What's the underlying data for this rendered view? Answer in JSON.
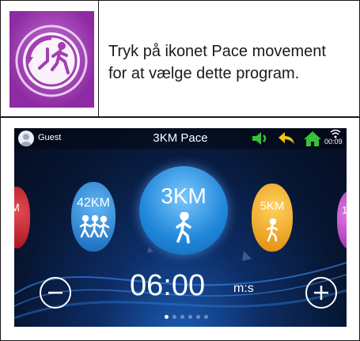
{
  "instruction": {
    "line1": "Tryk på ikonet Pace movement",
    "line2": "for at vælge dette program."
  },
  "app_icon": {
    "name": "pace-movement-icon",
    "color": "#a33fb3"
  },
  "screen": {
    "status_bar": {
      "user": "Guest",
      "title": "3KM Pace",
      "time": "00:09",
      "icons": [
        "volume-icon",
        "back-arrow-icon",
        "home-icon",
        "wifi-icon"
      ]
    },
    "programs": [
      {
        "label": "M",
        "color": "#c01f2a"
      },
      {
        "label": "42KM",
        "color": "#1e7fd0"
      },
      {
        "label": "3KM",
        "color": "#2a9be6",
        "selected": true
      },
      {
        "label": "5KM",
        "color": "#f0a41c"
      },
      {
        "label": "10",
        "color": "#c34bc9"
      }
    ],
    "pace_value": "06:00",
    "pace_unit": "m:s",
    "page_indicator": {
      "pages": 6,
      "current": 1
    }
  }
}
